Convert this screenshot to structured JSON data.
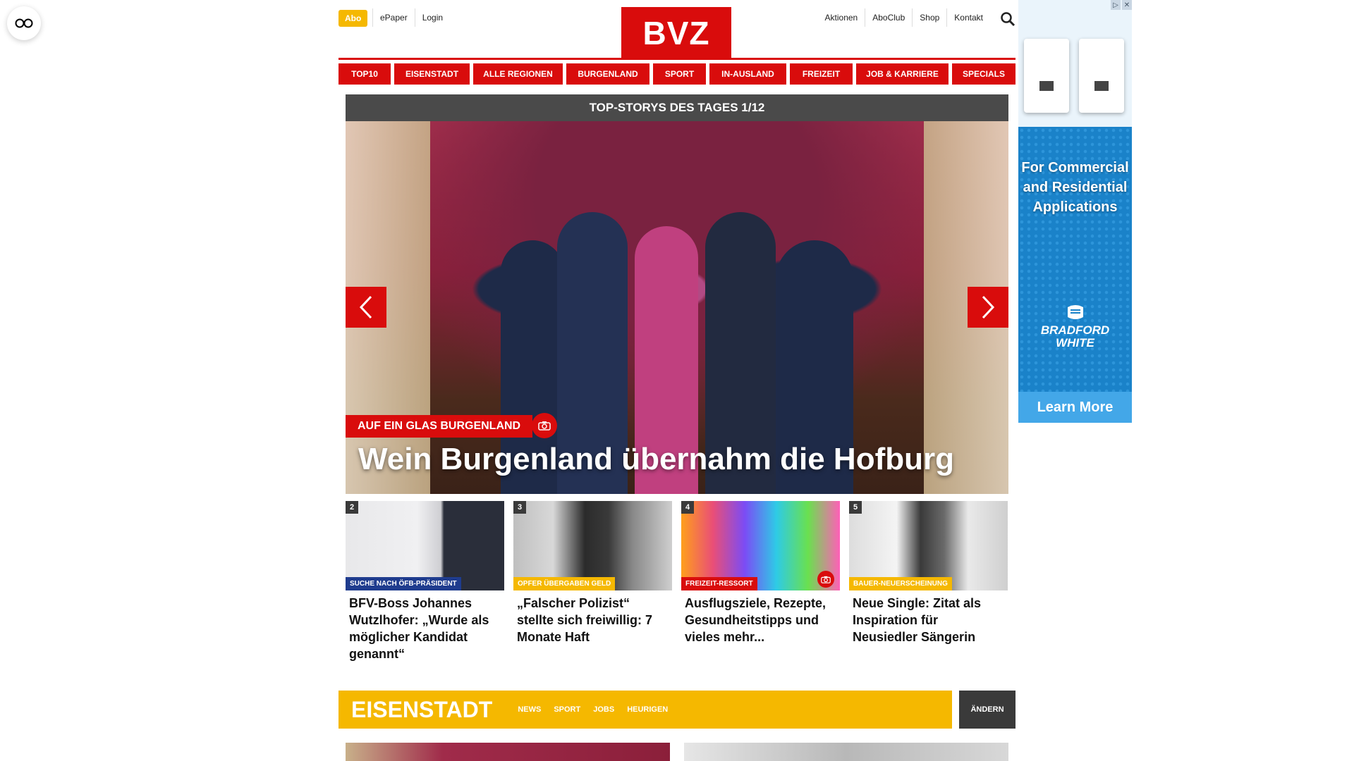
{
  "header": {
    "abo_label": "Abo",
    "left_links": [
      "ePaper",
      "Login"
    ],
    "logo_text": "BVZ",
    "right_links": [
      "Aktionen",
      "AboClub",
      "Shop",
      "Kontakt"
    ]
  },
  "nav": {
    "items": [
      "TOP10",
      "EISENSTADT",
      "ALLE REGIONEN",
      "BURGENLAND",
      "SPORT",
      "IN-AUSLAND",
      "FREIZEIT",
      "JOB & KARRIERE",
      "SPECIALS"
    ]
  },
  "hero": {
    "heading": "TOP-STORYS DES TAGES 1/12",
    "tag": "AUF EIN GLAS BURGENLAND",
    "title": "Wein Burgenland übernahm die Hofburg"
  },
  "cards": [
    {
      "num": "2",
      "tag": "SUCHE NACH ÖFB-PRÄSIDENT",
      "tag_color": "#1f3c8e",
      "title": "BFV-Boss Johannes Wutzlhofer: „Wurde als möglicher Kandidat genannt“"
    },
    {
      "num": "3",
      "tag": "OPFER ÜBERGABEN GELD",
      "tag_color": "#f5b800",
      "title": "„Falscher Polizist“ stellte sich freiwillig: 7 Monate Haft"
    },
    {
      "num": "4",
      "tag": "FREIZEIT-RESSORT",
      "tag_color": "#d90c0c",
      "title": "Ausflugsziele, Rezepte, Gesundheitstipps und vieles mehr..."
    },
    {
      "num": "5",
      "tag": "BAUER-NEUERSCHEINUNG",
      "tag_color": "#f5b800",
      "title": "Neue Single: Zitat als Inspiration für Neusiedler Sängerin"
    }
  ],
  "region": {
    "title": "EISENSTADT",
    "links": [
      "NEWS",
      "SPORT",
      "JOBS",
      "HEURIGEN"
    ],
    "change_label": "ÄNDERN"
  },
  "ad": {
    "text": "For Commercial and Residential Applications",
    "brand_line1": "BRADFORD",
    "brand_line2": "WHITE",
    "cta": "Learn More"
  }
}
